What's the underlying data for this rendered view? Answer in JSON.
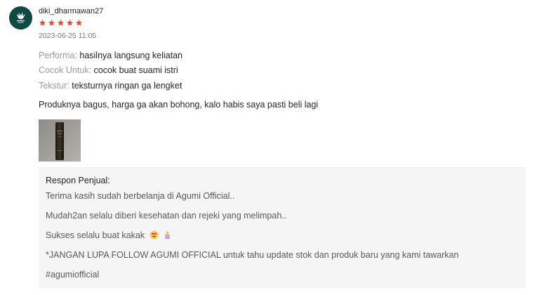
{
  "review": {
    "username": "diki_dharmawan27",
    "rating": 5,
    "rating_color": "#ee4d2d",
    "timestamp": "2023-06-25 11:05",
    "attributes": [
      {
        "label": "Performa:",
        "value": "hasilnya langsung keliatan"
      },
      {
        "label": "Cocok Untuk:",
        "value": "cocok buat suami istri"
      },
      {
        "label": "Tekstur:",
        "value": "teksturnya ringan ga lengket"
      }
    ],
    "comment": "Produknya bagus, harga ga akan bohong, kalo habis saya pasti beli lagi",
    "avatar_color": "#0e4a44"
  },
  "seller_response": {
    "title": "Respon Penjual:",
    "lines": [
      "Terima kasih sudah berbelanja di Agumi Official..",
      "Mudah2an selalu diberi kesehatan dan rejeki yang melimpah..",
      "Sukses selalu buat kakak",
      "*JANGAN LUPA FOLLOW AGUMI OFFICIAL untuk tahu update stok dan produk baru yang kami tawarkan",
      "#agumiofficial"
    ],
    "line3_emojis": [
      "smiling-face-with-heart-eyes-emoji",
      "person-with-folded-hands-emoji"
    ]
  }
}
